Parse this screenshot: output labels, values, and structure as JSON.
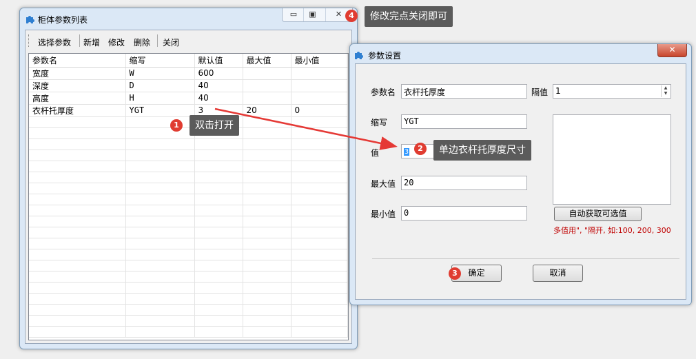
{
  "main_window": {
    "title": "柜体参数列表",
    "toolbar": [
      "选择参数",
      "新增",
      "修改",
      "删除",
      "关闭"
    ],
    "columns": [
      "参数名",
      "缩写",
      "默认值",
      "最大值",
      "最小值"
    ],
    "rows": [
      [
        "宽度",
        "W",
        "600",
        "",
        ""
      ],
      [
        "深度",
        "D",
        "40",
        "",
        ""
      ],
      [
        "高度",
        "H",
        "40",
        "",
        ""
      ],
      [
        "衣杆托厚度",
        "YGT",
        "3",
        "20",
        "0"
      ]
    ]
  },
  "dialog": {
    "title": "参数设置",
    "close_label": "✕",
    "name_label": "参数名",
    "name_value": "衣杆托厚度",
    "interval_label": "隔值",
    "interval_value": "1",
    "abbr_label": "缩写",
    "abbr_value": "YGT",
    "value_label": "值",
    "value_value": "3",
    "max_label": "最大值",
    "max_value": "20",
    "min_label": "最小值",
    "min_value": "0",
    "auto_button": "自动获取可选值",
    "hint": "多值用\", \"隔开, 如:100, 200, 300",
    "ok_button": "确定",
    "cancel_button": "取消"
  },
  "annotations": {
    "step1": {
      "num": "1",
      "text": "双击打开"
    },
    "step2": {
      "num": "2",
      "text": "单边衣杆托厚度尺寸"
    },
    "step3": {
      "num": "3"
    },
    "step4": {
      "num": "4",
      "text": "修改完点关闭即可"
    }
  },
  "colors": {
    "badge": "#e03c31",
    "callout_bg": "#5b5b5b",
    "hint_text": "#c00000",
    "arrow": "#e53935"
  }
}
